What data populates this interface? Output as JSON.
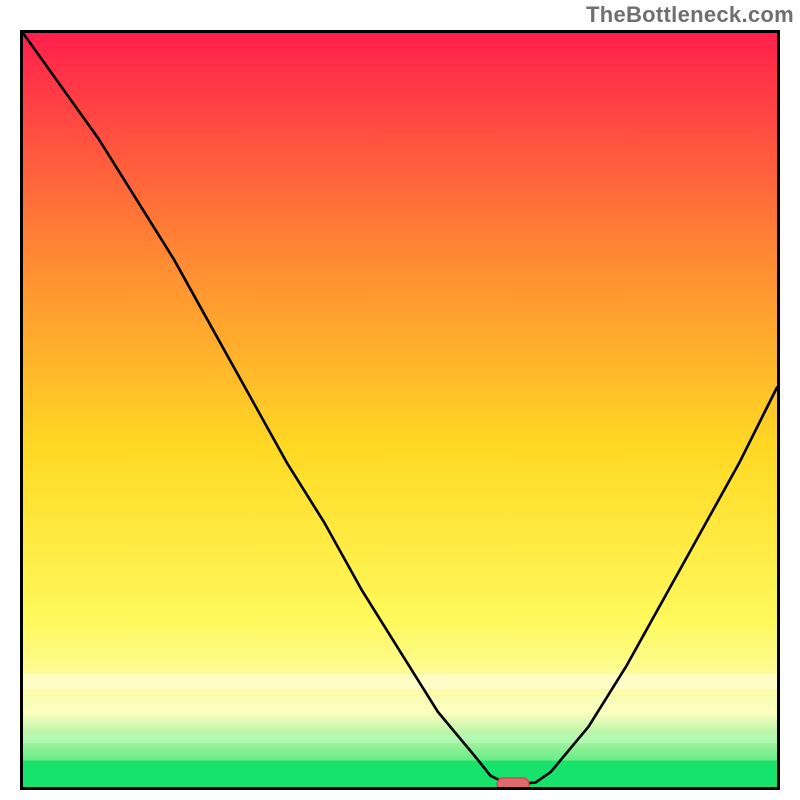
{
  "watermark": "TheBottleneck.com",
  "colors": {
    "gradient_top": "#ff1f4b",
    "gradient_mid_upper": "#ff8a33",
    "gradient_mid": "#ffd924",
    "gradient_mid_lower": "#fff95c",
    "gradient_band_yellow": "#fdfec0",
    "gradient_green": "#17e26b",
    "curve": "#000000",
    "marker_fill": "#e06a6f",
    "marker_stroke": "#c94b52",
    "border": "#000000"
  },
  "chart_data": {
    "type": "line",
    "title": "",
    "xlabel": "",
    "ylabel": "",
    "xlim": [
      0,
      100
    ],
    "ylim": [
      0,
      100
    ],
    "x": [
      0,
      5,
      10,
      15,
      20,
      25,
      30,
      35,
      40,
      45,
      50,
      55,
      60,
      62,
      64,
      66,
      68,
      70,
      75,
      80,
      85,
      90,
      95,
      100
    ],
    "values": [
      100,
      93,
      86,
      78,
      70,
      61,
      52,
      43,
      35,
      26,
      18,
      10,
      4,
      1.5,
      0.5,
      0.4,
      0.6,
      2,
      8,
      16,
      25,
      34,
      43,
      53
    ],
    "marker": {
      "x": 65,
      "y": 0.4,
      "label": ""
    },
    "notes": "Background is a vertical red→green gradient; the black curve descends from top-left toward a minimum near x≈65 then rises; a small rounded pink marker sits at the minimum near the bottom axis."
  }
}
